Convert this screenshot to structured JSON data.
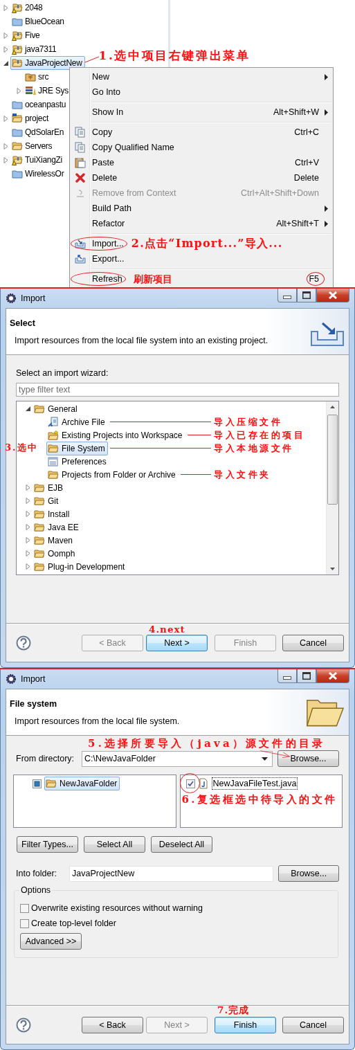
{
  "explorer": {
    "items": [
      {
        "label": "2048",
        "kind": "warning-project",
        "expanded": false,
        "selected": false
      },
      {
        "label": "BlueOcean",
        "kind": "closed-project",
        "selected": false
      },
      {
        "label": "Five",
        "kind": "warning-project",
        "expanded": false,
        "selected": false
      },
      {
        "label": "java7311",
        "kind": "warning-project",
        "expanded": false,
        "selected": false
      },
      {
        "label": "JavaProjectNew",
        "kind": "open-project",
        "expanded": true,
        "selected": true,
        "note": "1.选中项目右键弹出菜单",
        "children": [
          {
            "label": "src",
            "kind": "source-folder",
            "selected": false
          },
          {
            "label": "JRE Sys",
            "kind": "library",
            "expanded": false,
            "selected": false
          }
        ]
      },
      {
        "label": "oceanpastu",
        "kind": "closed-project",
        "selected": false
      },
      {
        "label": "project",
        "kind": "maven-project",
        "expanded": false,
        "selected": false
      },
      {
        "label": "QdSolarEn",
        "kind": "closed-project",
        "selected": false
      },
      {
        "label": "Servers",
        "kind": "folder",
        "expanded": false,
        "selected": false
      },
      {
        "label": "TuiXiangZi",
        "kind": "warning-project",
        "expanded": false,
        "selected": false
      },
      {
        "label": "WirelessOr",
        "kind": "closed-project",
        "selected": false
      }
    ]
  },
  "context_menu": {
    "items": [
      {
        "kind": "item",
        "label": "New",
        "submenu": true,
        "disabled": false,
        "circled": false
      },
      {
        "kind": "item",
        "label": "Go Into",
        "submenu": false,
        "disabled": false,
        "circled": false
      },
      {
        "kind": "separator"
      },
      {
        "kind": "item",
        "label": "Show In",
        "shortcut": {
          "text": "Alt+Shift+W",
          "circled": false
        },
        "submenu": true,
        "disabled": false,
        "circled": false
      },
      {
        "kind": "separator"
      },
      {
        "kind": "item",
        "label": "Copy",
        "shortcut": {
          "text": "Ctrl+C",
          "circled": false
        },
        "submenu": false,
        "disabled": false,
        "circled": false
      },
      {
        "kind": "item",
        "label": "Copy Qualified Name",
        "submenu": false,
        "disabled": false,
        "circled": false
      },
      {
        "kind": "item",
        "label": "Paste",
        "shortcut": {
          "text": "Ctrl+V",
          "circled": false
        },
        "submenu": false,
        "disabled": false,
        "circled": false
      },
      {
        "kind": "item",
        "label": "Delete",
        "shortcut": {
          "text": "Delete",
          "circled": false
        },
        "submenu": false,
        "disabled": false,
        "circled": false
      },
      {
        "kind": "item",
        "label": "Remove from Context",
        "shortcut": {
          "text": "Ctrl+Alt+Shift+Down",
          "circled": false
        },
        "submenu": false,
        "disabled": true,
        "circled": false
      },
      {
        "kind": "item",
        "label": "Build Path",
        "submenu": true,
        "disabled": false,
        "circled": false
      },
      {
        "kind": "item",
        "label": "Refactor",
        "shortcut": {
          "text": "Alt+Shift+T",
          "circled": false
        },
        "submenu": true,
        "disabled": false,
        "circled": false
      },
      {
        "kind": "separator"
      },
      {
        "kind": "item",
        "label": "Import...",
        "submenu": false,
        "disabled": false,
        "circled": true,
        "note": "2.点击“Import...”导入..."
      },
      {
        "kind": "item",
        "label": "Export...",
        "submenu": false,
        "disabled": false,
        "circled": false
      },
      {
        "kind": "separator"
      },
      {
        "kind": "item",
        "label": "Refresh",
        "shortcut": {
          "text": "F5",
          "circled": true
        },
        "submenu": false,
        "disabled": false,
        "circled": true,
        "note": "刷新项目"
      }
    ]
  },
  "import_dialog": {
    "title": "Import",
    "heading": "Select",
    "description": "Import resources from the local file system into an existing project.",
    "wizard_label": "Select an import wizard:",
    "filter": {
      "placeholder": "type filter text"
    },
    "tree": [
      {
        "label": "General",
        "kind": "folder",
        "expanded": true,
        "selected": false,
        "children": [
          {
            "label": "Archive File",
            "kind": "archive",
            "selected": false,
            "note": "导入压缩文件"
          },
          {
            "label": "Existing Projects into Workspace",
            "kind": "projects",
            "selected": false,
            "note": "导入已存在的项目"
          },
          {
            "label": "File System",
            "kind": "folder",
            "selected": true,
            "note": "导入本地源文件",
            "side_note": "3.选中"
          },
          {
            "label": "Preferences",
            "kind": "preferences",
            "selected": false
          },
          {
            "label": "Projects from Folder or Archive",
            "kind": "folder",
            "selected": false,
            "note": "导入文件夹"
          }
        ]
      },
      {
        "label": "EJB",
        "kind": "folder",
        "expanded": false,
        "selected": false
      },
      {
        "label": "Git",
        "kind": "folder",
        "expanded": false,
        "selected": false
      },
      {
        "label": "Install",
        "kind": "folder",
        "expanded": false,
        "selected": false
      },
      {
        "label": "Java EE",
        "kind": "folder",
        "expanded": false,
        "selected": false
      },
      {
        "label": "Maven",
        "kind": "folder",
        "expanded": false,
        "selected": false
      },
      {
        "label": "Oomph",
        "kind": "folder",
        "expanded": false,
        "selected": false
      },
      {
        "label": "Plug-in Development",
        "kind": "folder",
        "expanded": false,
        "selected": false
      }
    ],
    "buttons": [
      {
        "label": "< Back",
        "disabled": true,
        "default": false
      },
      {
        "label": "Next >",
        "disabled": false,
        "default": true,
        "note": "4.next"
      },
      {
        "label": "Finish",
        "disabled": true,
        "default": false
      },
      {
        "label": "Cancel",
        "disabled": false,
        "default": false
      }
    ]
  },
  "file_system_dialog": {
    "title": "Import",
    "heading": "File system",
    "description": "Import resources from the local file system.",
    "note": "5.选择所要导入（java）源文件的目录",
    "from_directory": {
      "label": "From directory:",
      "value": "C:\\NewJavaFolder",
      "button": "Browse..."
    },
    "folders": [
      {
        "label": "NewJavaFolder",
        "checked": true,
        "partial": true,
        "selected": true
      }
    ],
    "files": [
      {
        "label": "NewJavaFileTest.java",
        "checked": true,
        "partial": false,
        "selected": true,
        "circled": true,
        "note": "6.复选框选中待导入的文件"
      }
    ],
    "selection_buttons": [
      "Filter Types...",
      "Select All",
      "Deselect All"
    ],
    "into_folder": {
      "label": "Into folder:",
      "value": "JavaProjectNew",
      "button": "Browse..."
    },
    "options": {
      "title": "Options",
      "checkboxes": [
        {
          "label": "Overwrite existing resources without warning",
          "checked": false
        },
        {
          "label": "Create top-level folder",
          "checked": false
        }
      ],
      "advanced": "Advanced >>"
    },
    "buttons": [
      {
        "label": "< Back",
        "disabled": false,
        "default": false
      },
      {
        "label": "Next >",
        "disabled": true,
        "default": false
      },
      {
        "label": "Finish",
        "disabled": false,
        "default": true,
        "note": "7.完成"
      },
      {
        "label": "Cancel",
        "disabled": false,
        "default": false
      }
    ]
  }
}
